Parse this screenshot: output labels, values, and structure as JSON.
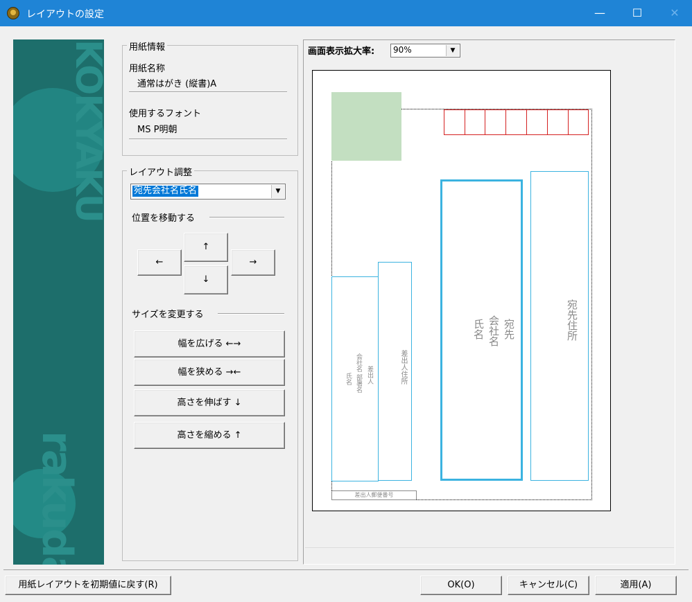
{
  "window": {
    "title": "レイアウトの設定",
    "minimize": "—",
    "maximize": "☐",
    "close": "✕"
  },
  "banner": {
    "text_top": "KOKYAKU",
    "text_bottom": "rakuda"
  },
  "paper_info": {
    "group_title": "用紙情報",
    "paper_name_label": "用紙名称",
    "paper_name_value": "通常はがき (縦書)A",
    "font_label": "使用するフォント",
    "font_value": "MS P明朝"
  },
  "layout": {
    "group_title": "レイアウト調整",
    "item_select_value": "宛先会社名氏名",
    "move_label": "位置を移動する",
    "move_left": "←",
    "move_up": "↑",
    "move_down": "↓",
    "move_right": "→",
    "size_label": "サイズを変更する",
    "widen": "幅を広げる ←→",
    "narrow": "幅を狭める →←",
    "taller": "高さを伸ばす ↓",
    "shorter": "高さを縮める ↑"
  },
  "preview": {
    "zoom_label": "画面表示拡大率:",
    "zoom_value": "90%",
    "labels": {
      "recipient_address": "宛先住所",
      "recipient_col1": "宛先",
      "recipient_col2": "会社名",
      "recipient_col3": "氏名",
      "sender_address": "差出人住所",
      "sender_col1": "差出人",
      "sender_col2": "会社名 部署名",
      "sender_col3": "氏名",
      "sender_zip": "差出人郵便番号"
    }
  },
  "footer": {
    "reset": "用紙レイアウトを初期値に戻す(R)",
    "ok": "OK(O)",
    "cancel": "キャンセル(C)",
    "apply": "適用(A)"
  },
  "icons": {
    "app": "app-icon",
    "dropdown": "chevron-down-icon"
  }
}
